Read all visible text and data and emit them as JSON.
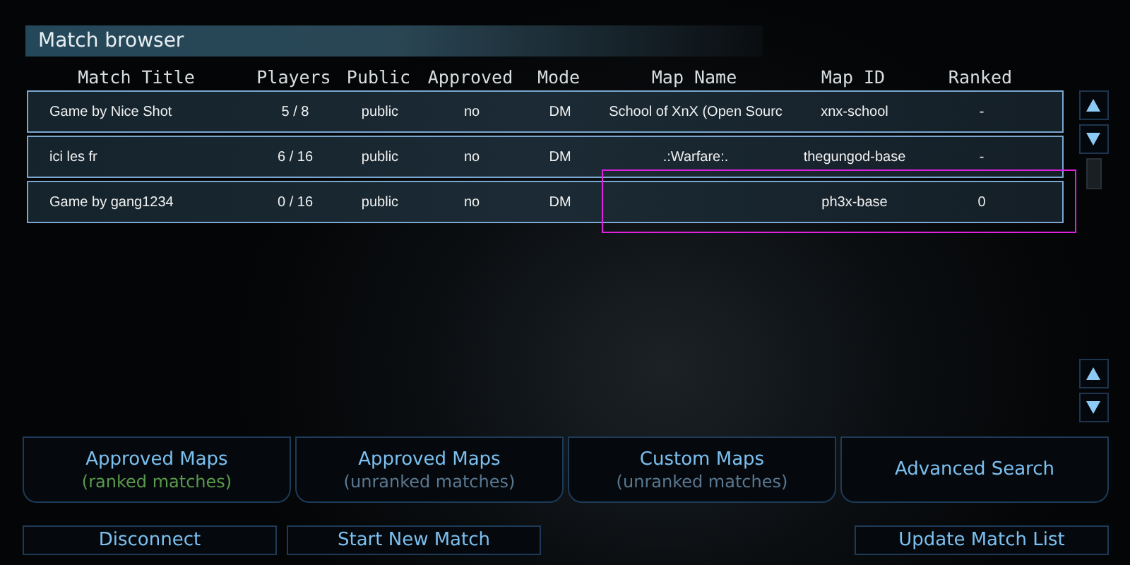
{
  "window": {
    "title": "Match browser"
  },
  "table": {
    "columns": [
      "Match Title",
      "Players",
      "Public",
      "Approved",
      "Mode",
      "Map Name",
      "Map ID",
      "Ranked"
    ],
    "rows": [
      [
        "Game by Nice Shot",
        "5 / 8",
        "public",
        "no",
        "DM",
        "School of XnX (Open Sourc",
        "xnx-school",
        "-"
      ],
      [
        "ici les fr",
        "6 / 16",
        "public",
        "no",
        "DM",
        ".:Warfare:.",
        "thegungod-base",
        "-"
      ],
      [
        "Game by gang1234",
        "0 / 16",
        "public",
        "no",
        "DM",
        null,
        "ph3x-base",
        "0"
      ]
    ]
  },
  "filters": [
    {
      "label": "Approved Maps",
      "sublabel": "(ranked matches)",
      "color": "#5a9a4a"
    },
    {
      "label": "Approved Maps",
      "sublabel": "(unranked matches)",
      "color": "#5a7890"
    },
    {
      "label": "Custom Maps",
      "sublabel": "(unranked matches)",
      "color": "#5a7890"
    },
    {
      "label": "Advanced Search"
    }
  ],
  "left_buttons": [
    "Disconnect",
    "Start New Match"
  ],
  "right_buttons": [
    "Update Match List"
  ]
}
